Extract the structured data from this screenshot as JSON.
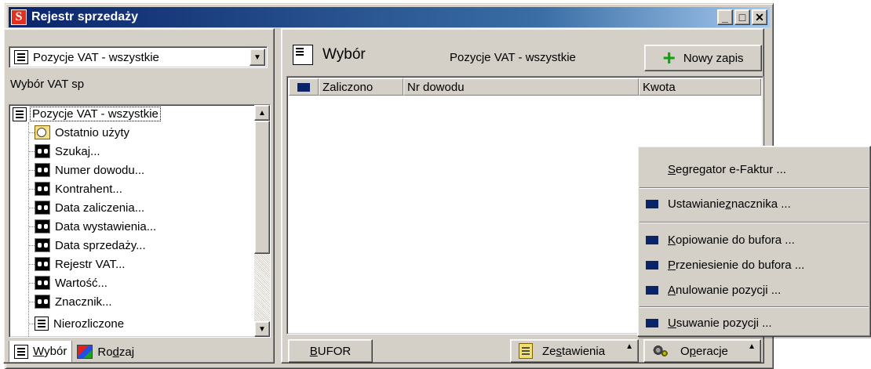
{
  "window": {
    "title": "Rejestr sprzedaży",
    "app_icon_letter": "S",
    "buttons": {
      "minimize": "_",
      "maximize": "□",
      "close": "✕"
    }
  },
  "left_panel": {
    "combo_value": "Pozycje VAT - wszystkie",
    "section_label": "Wybór VAT sp",
    "tree": {
      "root": "Pozycje VAT - wszystkie",
      "items": [
        {
          "label": "Ostatnio użyty",
          "icon": "recent-icon"
        },
        {
          "label": "Szukaj...",
          "icon": "binoculars-icon"
        },
        {
          "label": "Numer dowodu...",
          "icon": "binoculars-icon"
        },
        {
          "label": "Kontrahent...",
          "icon": "binoculars-icon"
        },
        {
          "label": "Data zaliczenia...",
          "icon": "binoculars-icon"
        },
        {
          "label": "Data wystawienia...",
          "icon": "binoculars-icon"
        },
        {
          "label": "Data sprzedaży...",
          "icon": "binoculars-icon"
        },
        {
          "label": "Rejestr VAT...",
          "icon": "binoculars-icon"
        },
        {
          "label": "Wartość...",
          "icon": "binoculars-icon"
        },
        {
          "label": "Znacznik...",
          "icon": "binoculars-icon"
        },
        {
          "label": "Nierozliczone",
          "icon": "document-icon"
        }
      ]
    },
    "tabs": {
      "wybor_pre": "W",
      "wybor_post": "ybór",
      "rodzaj_pre": "Ro",
      "rodzaj_u": "d",
      "rodzaj_post": "zaj"
    }
  },
  "right_panel": {
    "title": "Wybór",
    "subtitle": "Pozycje VAT - wszystkie",
    "new_button": "Nowy zapis",
    "columns": [
      "Zaliczono",
      "Nr dowodu",
      "Kwota"
    ],
    "bufor_button": {
      "u": "B",
      "rest": "UFOR"
    },
    "zestawienia_button": {
      "pre": "Ze",
      "u": "s",
      "post": "tawienia"
    },
    "operacje_button": {
      "pre": "O",
      "u": "p",
      "post": "eracje"
    }
  },
  "menu": {
    "segregator": {
      "u": "S",
      "rest": "egregator e-Faktur ..."
    },
    "ustawianie": {
      "pre": "Ustawianie ",
      "u": "z",
      "post": "nacznika ..."
    },
    "kopiowanie": {
      "u": "K",
      "rest": "opiowanie do bufora ..."
    },
    "przeniesienie": {
      "u": "P",
      "rest": "rzeniesienie do bufora ..."
    },
    "anulowanie": {
      "u": "A",
      "rest": "nulowanie pozycji ..."
    },
    "usuwanie": {
      "u": "U",
      "rest": "suwanie pozycji ..."
    }
  },
  "colors": {
    "title_start": "#0a246a",
    "title_end": "#a6caf0",
    "face": "#d4d0c8",
    "marker": "#0a246a",
    "plus": "#10a010"
  }
}
